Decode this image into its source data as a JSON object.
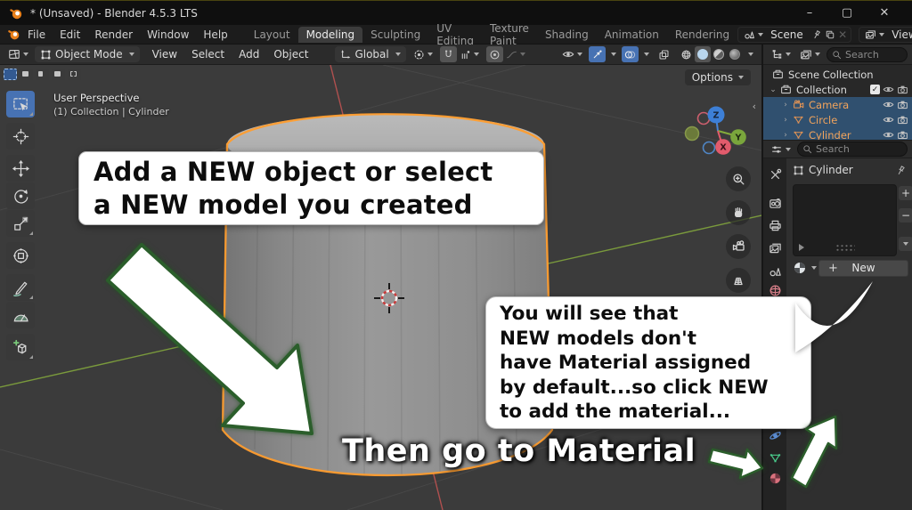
{
  "window": {
    "title": "* (Unsaved) - Blender 4.5.3 LTS",
    "minimize": "–",
    "maximize": "▢",
    "close": "✕"
  },
  "menubar": {
    "menus": [
      "File",
      "Edit",
      "Render",
      "Window",
      "Help"
    ],
    "workspaces": [
      "Layout",
      "Modeling",
      "Sculpting",
      "UV Editing",
      "Texture Paint",
      "Shading",
      "Animation",
      "Rendering"
    ],
    "active_workspace": "Modeling",
    "scene": {
      "value": "Scene"
    },
    "view_layer": {
      "value": "ViewLayer"
    }
  },
  "viewport_header": {
    "mode": "Object Mode",
    "menus": [
      "View",
      "Select",
      "Add",
      "Object"
    ],
    "orientation": "Global"
  },
  "viewport": {
    "view_label": "User Perspective",
    "context_label": "(1) Collection | Cylinder",
    "options_label": "Options",
    "gizmo_axes": {
      "x": "X",
      "y": "Y",
      "z": "Z"
    },
    "tools": [
      "select-box",
      "cursor",
      "move",
      "rotate",
      "scale",
      "transform",
      "annotate",
      "measure",
      "add-cube"
    ]
  },
  "annotations": {
    "note": {
      "line1": "Add a NEW object or select",
      "line2": "a NEW model you created"
    },
    "bubble": {
      "line1": "You will see that",
      "line2": "NEW models don't",
      "line3": "have Material assigned",
      "line4": "by default...so click NEW",
      "line5": "to add the material..."
    },
    "caption": "Then go to Material"
  },
  "outliner": {
    "search_placeholder": "Search",
    "rows": [
      {
        "label": "Scene Collection"
      },
      {
        "label": "Collection"
      },
      {
        "label": "Camera"
      },
      {
        "label": "Circle"
      },
      {
        "label": "Cylinder"
      }
    ]
  },
  "properties": {
    "search_placeholder": "Search",
    "breadcrumb": "Cylinder",
    "new_button": "New",
    "plus_label": "+",
    "minus_label": "−",
    "tabs": [
      "tool",
      "render",
      "output",
      "view-layer",
      "scene",
      "world",
      "physics",
      "object-data",
      "material"
    ]
  },
  "colors": {
    "accent_blue": "#4772b3",
    "selection_orange": "#f2a45c",
    "outline_orange": "#ff9d2e",
    "solid_shading": "#b9d6ee"
  }
}
